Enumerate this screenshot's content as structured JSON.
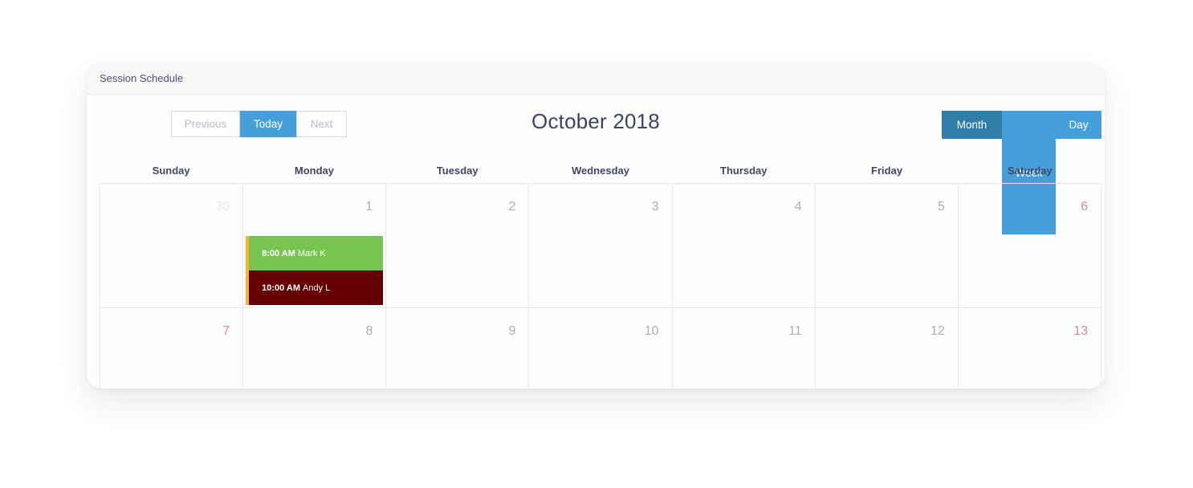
{
  "card": {
    "title": "Session Schedule"
  },
  "toolbar": {
    "previous_label": "Previous",
    "today_label": "Today",
    "next_label": "Next",
    "title": "October 2018",
    "views": [
      {
        "label": "Month",
        "active": true
      },
      {
        "label": "Week",
        "active": false
      },
      {
        "label": "Day",
        "active": false
      }
    ]
  },
  "weekdays": [
    "Sunday",
    "Monday",
    "Tuesday",
    "Wednesday",
    "Thursday",
    "Friday",
    "Saturday"
  ],
  "weeks": [
    [
      {
        "day": "30",
        "other": true,
        "weekend": true
      },
      {
        "day": "1",
        "events": [
          {
            "time": "8:00 AM",
            "title": "Mark K",
            "color": "#76c550"
          },
          {
            "time": "10:00 AM",
            "title": "Andy L",
            "color": "#650000"
          }
        ]
      },
      {
        "day": "2"
      },
      {
        "day": "3"
      },
      {
        "day": "4"
      },
      {
        "day": "5"
      },
      {
        "day": "6",
        "weekend": true
      }
    ],
    [
      {
        "day": "7",
        "weekend": true
      },
      {
        "day": "8"
      },
      {
        "day": "9"
      },
      {
        "day": "10"
      },
      {
        "day": "11"
      },
      {
        "day": "12"
      },
      {
        "day": "13",
        "weekend": true
      }
    ]
  ],
  "colors": {
    "accent": "#45a0d9",
    "active_view": "#2e7ea9",
    "event_border": "#f2b53a"
  }
}
